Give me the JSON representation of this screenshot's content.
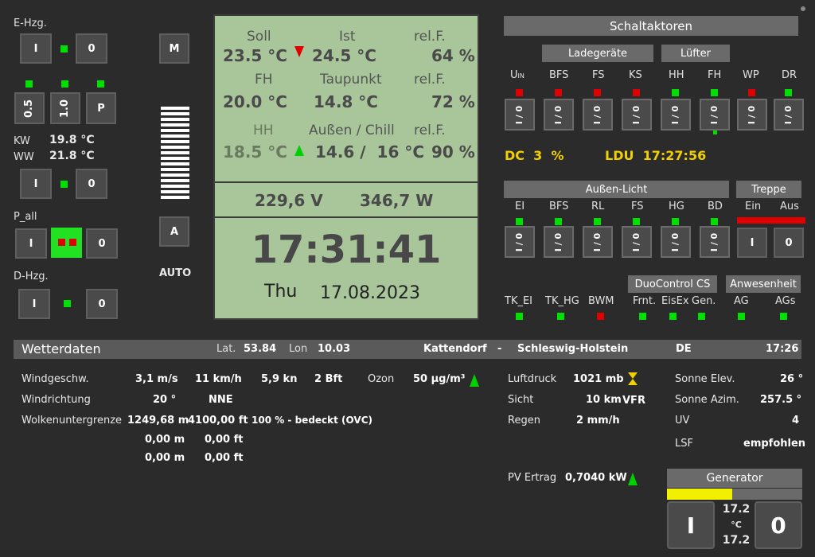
{
  "left": {
    "ehzg_label": "E-Hzg.",
    "btn_i": "I",
    "btn_0": "0",
    "btn_05": "0.5",
    "btn_10": "1.0",
    "btn_p": "P",
    "kw_label": "KW",
    "kw_value": "19.8 °C",
    "ww_label": "WW",
    "ww_value": "21.8 °C",
    "pall_label": "P_all",
    "dhzg_label": "D-Hzg."
  },
  "mode": {
    "m_label": "M",
    "a_label": "A",
    "auto_label": "AUTO"
  },
  "climate": {
    "soll_label": "Soll",
    "soll_value": "23.5 °C",
    "ist_label": "Ist",
    "ist_value": "24.5 °C",
    "relf1_label": "rel.F.",
    "relf1_value": "64 %",
    "fh_label": "FH",
    "fh_value": "20.0 °C",
    "taupunkt_label": "Taupunkt",
    "taupunkt_value": "14.8 °C",
    "relf2_label": "rel.F.",
    "relf2_value": "72 %",
    "hh_label": "HH",
    "hh_value": "18.5 °C",
    "aussen_label": "Außen / Chill",
    "aussen_value": "14.6 /  16 °C",
    "relf3_label": "rel.F.",
    "relf3_value": "90 %",
    "voltage": "229,6 V",
    "power": "346,7 W",
    "time": "17:31:41",
    "day": "Thu",
    "date": "17.08.2023"
  },
  "actuators": {
    "title": "Schaltaktoren",
    "group_lade": "Ladegeräte",
    "group_luefter": "Lüfter",
    "u_label": "U",
    "u_sub": "IN",
    "cols": [
      "BFS",
      "FS",
      "KS",
      "HH",
      "FH",
      "WP",
      "DR"
    ],
    "switch_label": "I / 0",
    "dc_label": "DC  3  %",
    "ldu_label": "LDU  17:27:56",
    "aussen_title": "Außen-Licht",
    "treppe_title": "Treppe",
    "aussen_cols": [
      "EI",
      "BFS",
      "RL",
      "FS",
      "HG",
      "BD"
    ],
    "treppe_ein": "Ein",
    "treppe_aus": "Aus",
    "treppe_i": "I",
    "treppe_0": "0",
    "duo_title": "DuoControl CS",
    "anw_title": "Anwesenheit",
    "bottom_cols": [
      "TK_EI",
      "TK_HG",
      "BWM",
      "Frnt.",
      "EisEx",
      "Gen.",
      "AG",
      "AGs"
    ]
  },
  "weather": {
    "title": "Wetterdaten",
    "lat_label": "Lat.",
    "lat_value": "53.84",
    "lon_label": "Lon",
    "lon_value": "10.03",
    "place": "Kattendorf",
    "dash": "-",
    "region": "Schleswig-Holstein",
    "country": "DE",
    "time": "17:26",
    "wind_label": "Windgeschw.",
    "wind_ms": "3,1 m/s",
    "wind_kmh": "11 km/h",
    "wind_kn": "5,9 kn",
    "wind_bft": "2 Bft",
    "ozon_label": "Ozon",
    "ozon_value": "50 µg/m³",
    "dir_label": "Windrichtung",
    "dir_deg": "20 °",
    "dir_name": "NNE",
    "cloud_label": "Wolkenuntergrenze",
    "cloud_m1": "1249,68 m",
    "cloud_ft1": "4100,00 ft",
    "cloud_desc": "100 % - bedeckt (OVC)",
    "cloud_m2": "0,00 m",
    "cloud_ft2": "0,00 ft",
    "cloud_m3": "0,00 m",
    "cloud_ft3": "0,00 ft",
    "pressure_label": "Luftdruck",
    "pressure_value": "1021 mb",
    "sight_label": "Sicht",
    "sight_value": "10 km",
    "sight_rule": "VFR",
    "rain_label": "Regen",
    "rain_value": "2 mm/h",
    "elev_label": "Sonne Elev.",
    "elev_value": "26 °",
    "azim_label": "Sonne Azim.",
    "azim_value": "257.5 °",
    "uv_label": "UV",
    "uv_value": "4",
    "lsf_label": "LSF",
    "lsf_value": "empfohlen",
    "pv_label": "PV Ertrag",
    "pv_value": "0,7040 kW"
  },
  "generator": {
    "title": "Generator",
    "fill_fraction": 0.48,
    "btn_i": "I",
    "btn_0": "0",
    "temp_top": "17.2",
    "temp_unit": "°C",
    "temp_bottom": "17.2"
  },
  "colors": {
    "panel": "#a9c59a",
    "led_green": "#00e000",
    "led_red": "#e00000",
    "yellow": "#f0d000"
  }
}
